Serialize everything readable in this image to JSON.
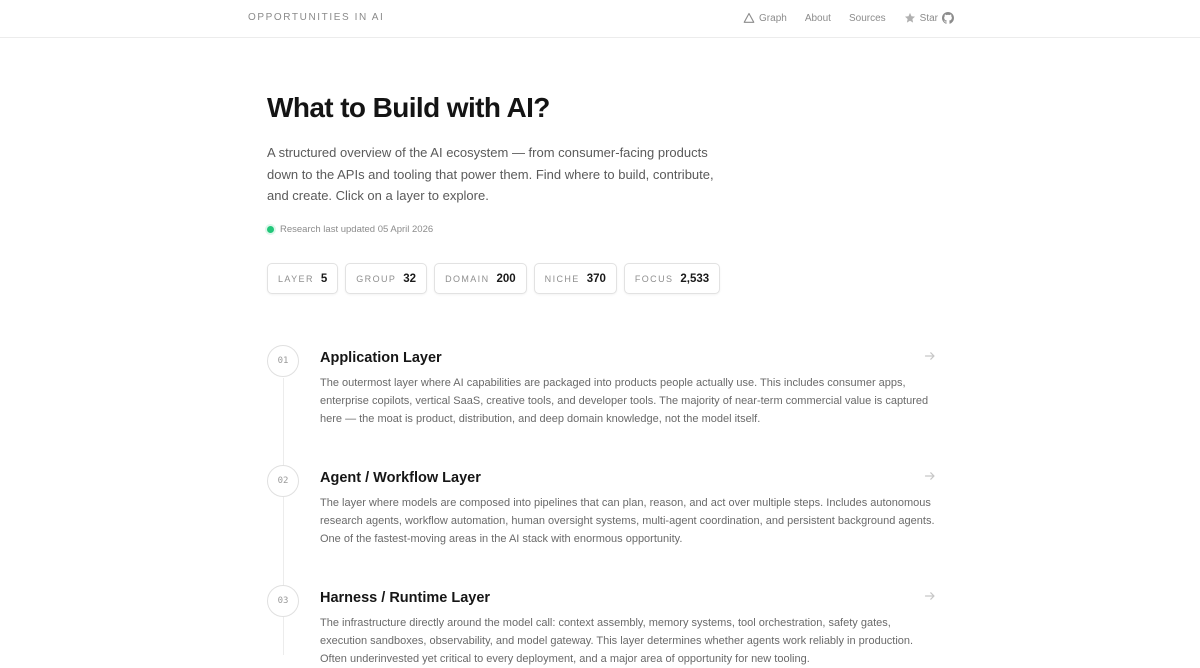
{
  "header": {
    "brand": "OPPORTUNITIES IN AI",
    "nav": [
      {
        "label": "Graph",
        "icon": "triangle-graph-icon"
      },
      {
        "label": "About"
      },
      {
        "label": "Sources"
      },
      {
        "label": "Star",
        "icon": "star-icon"
      }
    ],
    "github_icon": "github-icon"
  },
  "hero": {
    "title": "What to Build with AI?",
    "intro": "A structured overview of the AI ecosystem — from consumer-facing products down to the APIs and tooling that power them. Find where to build, contribute, and create. Click on a layer to explore.",
    "updated": "Research last updated 05 April 2026"
  },
  "stats": [
    {
      "label": "LAYER",
      "value": "5"
    },
    {
      "label": "GROUP",
      "value": "32"
    },
    {
      "label": "DOMAIN",
      "value": "200"
    },
    {
      "label": "NICHE",
      "value": "370"
    },
    {
      "label": "FOCUS",
      "value": "2,533"
    }
  ],
  "layers": [
    {
      "num": "01",
      "title": "Application Layer",
      "desc": "The outermost layer where AI capabilities are packaged into products people actually use. This includes consumer apps, enterprise copilots, vertical SaaS, creative tools, and developer tools. The majority of near-term commercial value is captured here — the moat is product, distribution, and deep domain knowledge, not the model itself."
    },
    {
      "num": "02",
      "title": "Agent / Workflow Layer",
      "desc": "The layer where models are composed into pipelines that can plan, reason, and act over multiple steps. Includes autonomous research agents, workflow automation, human oversight systems, multi-agent coordination, and persistent background agents. One of the fastest-moving areas in the AI stack with enormous opportunity."
    },
    {
      "num": "03",
      "title": "Harness / Runtime Layer",
      "desc": "The infrastructure directly around the model call: context assembly, memory systems, tool orchestration, safety gates, execution sandboxes, observability, and model gateway. This layer determines whether agents work reliably in production. Often underinvested yet critical to every deployment, and a major area of opportunity for new tooling."
    }
  ],
  "colors": {
    "accent_dot": "#22c77a",
    "text_primary": "#141414",
    "text_muted": "#6a6a6a",
    "border": "#e2e2e2"
  }
}
